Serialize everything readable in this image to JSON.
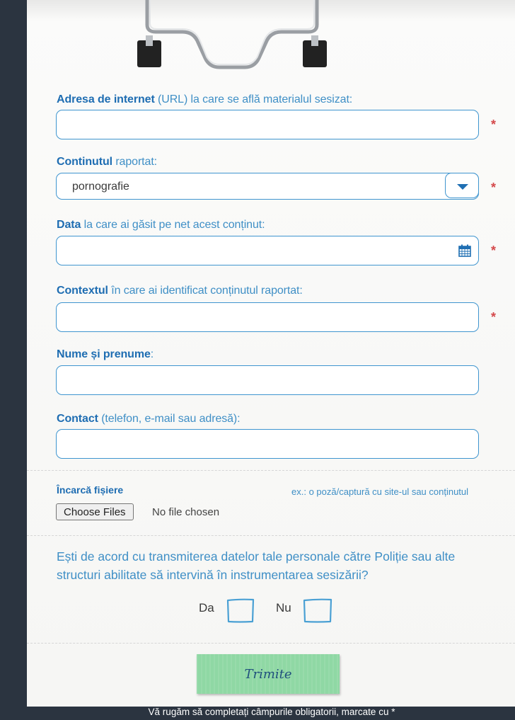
{
  "form": {
    "url_field": {
      "label_bold": "Adresa de internet",
      "label_rest": " (URL) la care se află materialul sesizat:",
      "value": "",
      "required_mark": "*"
    },
    "content_field": {
      "label_bold": "Continutul",
      "label_rest": " raportat:",
      "selected": "pornografie",
      "required_mark": "*"
    },
    "date_field": {
      "label_bold": "Data",
      "label_rest": " la care ai găsit pe net acest conținut:",
      "value": "",
      "required_mark": "*"
    },
    "context_field": {
      "label_bold": "Contextul",
      "label_rest": " în care ai identificat conținutul raportat:",
      "value": "",
      "required_mark": "*"
    },
    "name_field": {
      "label_bold": "Nume și prenume",
      "label_rest": ":",
      "value": ""
    },
    "contact_field": {
      "label_bold": "Contact",
      "label_rest": " (telefon, e-mail sau adresă):",
      "value": ""
    }
  },
  "upload": {
    "title": "Încarcă fișiere",
    "button_label": "Choose Files",
    "status": "No file chosen",
    "hint": "ex.: o poză/captură cu site-ul sau conținutul"
  },
  "consent": {
    "question": "Ești de acord cu transmiterea datelor tale personale către Poliție sau alte structuri abilitate să intervină în instrumentarea sesizării?",
    "yes_label": "Da",
    "no_label": "Nu"
  },
  "submit_label": "Trimite",
  "footer": "Vă rugăm să completați câmpurile obligatorii, marcate cu *",
  "colors": {
    "accent": "#3f95cf",
    "label_bold": "#1e6db2",
    "required": "#d4494b",
    "submit_bg": "#8fd8a4",
    "background": "#2b3440"
  },
  "icons": {
    "select": "chevron-down-icon",
    "date": "calendar-icon",
    "clip": "clipboard-clip-icon"
  }
}
